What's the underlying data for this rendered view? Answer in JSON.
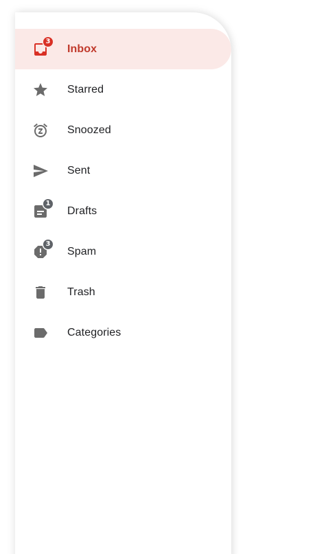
{
  "colors": {
    "active_bg": "#fbe9e7",
    "active_text": "#c0392b",
    "active_badge": "#d93025",
    "icon_grey": "#6b6b6b",
    "text": "#202124"
  },
  "nav": {
    "items": [
      {
        "label": "Inbox",
        "icon": "inbox-icon",
        "badge": "3",
        "active": true
      },
      {
        "label": "Starred",
        "icon": "star-icon"
      },
      {
        "label": "Snoozed",
        "icon": "snooze-alarm-icon"
      },
      {
        "label": "Sent",
        "icon": "send-icon"
      },
      {
        "label": "Drafts",
        "icon": "draft-icon",
        "badge": "1"
      },
      {
        "label": "Spam",
        "icon": "report-spam-icon",
        "badge": "3"
      },
      {
        "label": "Trash",
        "icon": "trash-icon"
      },
      {
        "label": "Categories",
        "icon": "label-icon"
      }
    ]
  }
}
